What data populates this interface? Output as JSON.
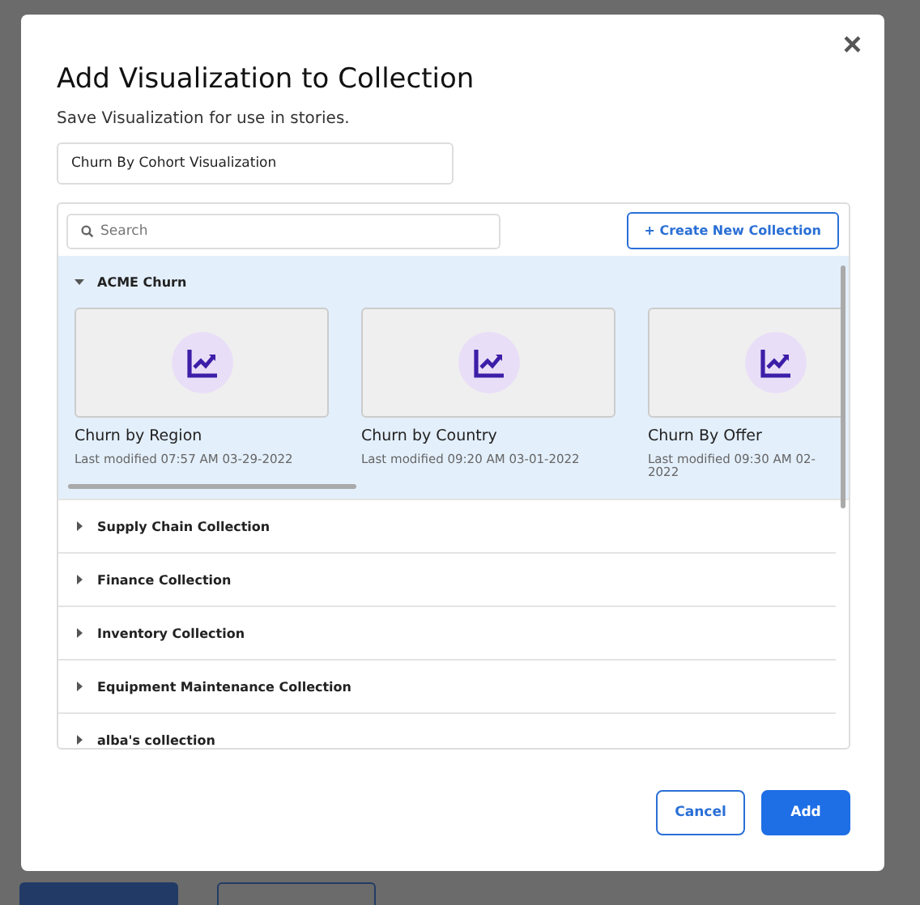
{
  "dialog": {
    "title": "Add Visualization to Collection",
    "subtitle": "Save Visualization for use in stories.",
    "name_value": "Churn By Cohort Visualization",
    "close": "×"
  },
  "search": {
    "placeholder": "Search"
  },
  "create_button": "+ Create New Collection",
  "collections": [
    {
      "name": "ACME Churn",
      "expanded": true,
      "visualizations": [
        {
          "title": "Churn by Region",
          "modified": "Last modified 07:57 AM 03-29-2022"
        },
        {
          "title": "Churn by Country",
          "modified": "Last modified 09:20 AM 03-01-2022"
        },
        {
          "title": "Churn By Offer",
          "modified": "Last modified 09:30 AM 02-2022"
        }
      ]
    },
    {
      "name": "Supply Chain Collection",
      "expanded": false
    },
    {
      "name": "Finance Collection",
      "expanded": false
    },
    {
      "name": "Inventory Collection",
      "expanded": false
    },
    {
      "name": "Equipment Maintenance Collection",
      "expanded": false
    },
    {
      "name": "alba's collection",
      "expanded": false
    }
  ],
  "buttons": [
    {
      "label": "Cancel",
      "kind": "secondary"
    },
    {
      "label": "Add",
      "kind": "primary"
    }
  ]
}
